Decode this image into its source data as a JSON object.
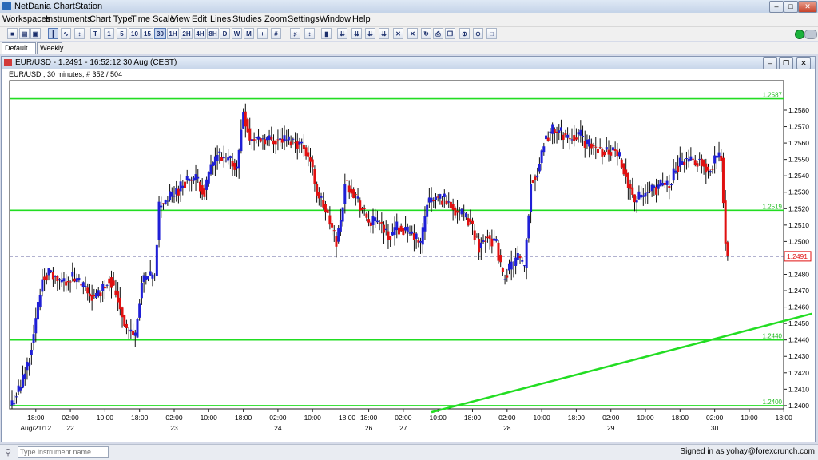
{
  "window": {
    "title": "NetDania ChartStation"
  },
  "menu": [
    "Workspaces",
    "Instruments",
    "Chart Type",
    "Time Scale",
    "View",
    "Edit",
    "Lines",
    "Studies",
    "Zoom",
    "Settings",
    "Window",
    "Help"
  ],
  "toolbar": {
    "timeframes": [
      "T",
      "1",
      "5",
      "10",
      "15",
      "30",
      "1H",
      "2H",
      "4H",
      "8H",
      "D",
      "W",
      "M"
    ],
    "selected": "30"
  },
  "tabs": [
    {
      "label": "Default",
      "active": true
    },
    {
      "label": "Weekly",
      "active": false
    }
  ],
  "chart_window": {
    "title": "EUR/USD - 1.2491 - 16:52:12  30 Aug (CEST)",
    "info": "EUR/USD , 30 minutes, # 352 / 504"
  },
  "status": {
    "search_placeholder": "Type instrument name",
    "signed_in": "Signed in as yohay@forexcrunch.com"
  },
  "chart_data": {
    "type": "candlestick",
    "symbol": "EUR/USD",
    "interval": "30 minutes",
    "ylim": [
      1.2398,
      1.2598
    ],
    "y_ticks": [
      "1.2400",
      "1.2410",
      "1.2420",
      "1.2430",
      "1.2440",
      "1.2450",
      "1.2460",
      "1.2470",
      "1.2480",
      "1.2490",
      "1.2500",
      "1.2510",
      "1.2520",
      "1.2530",
      "1.2540",
      "1.2550",
      "1.2560",
      "1.2570",
      "1.2580"
    ],
    "x_ticks": [
      {
        "time": "18:00",
        "date": "Aug/21/12",
        "i": 11
      },
      {
        "time": "02:00",
        "date": "22",
        "i": 27
      },
      {
        "time": "10:00",
        "date": "",
        "i": 43
      },
      {
        "time": "18:00",
        "date": "",
        "i": 59
      },
      {
        "time": "02:00",
        "date": "23",
        "i": 75
      },
      {
        "time": "10:00",
        "date": "",
        "i": 91
      },
      {
        "time": "18:00",
        "date": "",
        "i": 107
      },
      {
        "time": "02:00",
        "date": "24",
        "i": 123
      },
      {
        "time": "10:00",
        "date": "",
        "i": 139
      },
      {
        "time": "18:00",
        "date": "",
        "i": 155
      },
      {
        "time": "18:00",
        "date": "26",
        "i": 165
      },
      {
        "time": "02:00",
        "date": "27",
        "i": 181
      },
      {
        "time": "10:00",
        "date": "",
        "i": 197
      },
      {
        "time": "18:00",
        "date": "",
        "i": 213
      },
      {
        "time": "02:00",
        "date": "28",
        "i": 229
      },
      {
        "time": "10:00",
        "date": "",
        "i": 245
      },
      {
        "time": "18:00",
        "date": "",
        "i": 261
      },
      {
        "time": "02:00",
        "date": "29",
        "i": 277
      },
      {
        "time": "10:00",
        "date": "",
        "i": 293
      },
      {
        "time": "18:00",
        "date": "",
        "i": 309
      },
      {
        "time": "02:00",
        "date": "30",
        "i": 325
      },
      {
        "time": "10:00",
        "date": "",
        "i": 341
      },
      {
        "time": "18:00",
        "date": "",
        "i": 357
      }
    ],
    "bar_count": 352,
    "current_price": "1.2491",
    "horizontal_lines": [
      {
        "value": 1.2587,
        "label": "1.2587"
      },
      {
        "value": 1.2519,
        "label": "1.2519"
      },
      {
        "value": 1.244,
        "label": "1.2440"
      },
      {
        "value": 1.24,
        "label": "1.2400"
      }
    ],
    "trendline": {
      "from": {
        "i": 194,
        "value": 1.2396
      },
      "to": {
        "i": 370,
        "value": 1.2456
      }
    },
    "colors": {
      "up": "#1f1fd6",
      "down": "#e01010",
      "lines": "#22dd22",
      "price_tag": "#e01010"
    },
    "anchors": [
      [
        0,
        1.2402
      ],
      [
        4,
        1.2412
      ],
      [
        8,
        1.243
      ],
      [
        11,
        1.2452
      ],
      [
        14,
        1.2478
      ],
      [
        17,
        1.2481
      ],
      [
        22,
        1.2475
      ],
      [
        28,
        1.2478
      ],
      [
        33,
        1.2472
      ],
      [
        38,
        1.2465
      ],
      [
        41,
        1.247
      ],
      [
        45,
        1.2478
      ],
      [
        49,
        1.2465
      ],
      [
        53,
        1.2446
      ],
      [
        57,
        1.2443
      ],
      [
        60,
        1.2475
      ],
      [
        63,
        1.2478
      ],
      [
        66,
        1.2478
      ],
      [
        68,
        1.2522
      ],
      [
        72,
        1.2526
      ],
      [
        77,
        1.2532
      ],
      [
        81,
        1.2538
      ],
      [
        85,
        1.2538
      ],
      [
        89,
        1.253
      ],
      [
        92,
        1.2545
      ],
      [
        95,
        1.2553
      ],
      [
        98,
        1.2548
      ],
      [
        101,
        1.255
      ],
      [
        104,
        1.2544
      ],
      [
        107,
        1.258
      ],
      [
        110,
        1.2562
      ],
      [
        115,
        1.2563
      ],
      [
        121,
        1.2562
      ],
      [
        126,
        1.2562
      ],
      [
        131,
        1.2561
      ],
      [
        135,
        1.2558
      ],
      [
        138,
        1.2549
      ],
      [
        141,
        1.253
      ],
      [
        144,
        1.2522
      ],
      [
        147,
        1.2511
      ],
      [
        150,
        1.25
      ],
      [
        152,
        1.2512
      ],
      [
        154,
        1.2536
      ],
      [
        157,
        1.2532
      ],
      [
        160,
        1.2525
      ],
      [
        163,
        1.2516
      ],
      [
        166,
        1.2511
      ],
      [
        170,
        1.2513
      ],
      [
        174,
        1.2502
      ],
      [
        178,
        1.2509
      ],
      [
        182,
        1.2506
      ],
      [
        186,
        1.2503
      ],
      [
        189,
        1.2498
      ],
      [
        192,
        1.2524
      ],
      [
        196,
        1.2526
      ],
      [
        200,
        1.2526
      ],
      [
        204,
        1.2521
      ],
      [
        208,
        1.2516
      ],
      [
        212,
        1.2512
      ],
      [
        216,
        1.2497
      ],
      [
        220,
        1.2504
      ],
      [
        224,
        1.2498
      ],
      [
        227,
        1.2478
      ],
      [
        230,
        1.2483
      ],
      [
        234,
        1.249
      ],
      [
        237,
        1.2483
      ],
      [
        240,
        1.2536
      ],
      [
        243,
        1.2542
      ],
      [
        246,
        1.2561
      ],
      [
        250,
        1.2568
      ],
      [
        254,
        1.2566
      ],
      [
        258,
        1.2563
      ],
      [
        262,
        1.2566
      ],
      [
        266,
        1.2559
      ],
      [
        270,
        1.2557
      ],
      [
        274,
        1.2555
      ],
      [
        278,
        1.2556
      ],
      [
        282,
        1.2549
      ],
      [
        285,
        1.2536
      ],
      [
        288,
        1.2525
      ],
      [
        292,
        1.2528
      ],
      [
        296,
        1.2531
      ],
      [
        300,
        1.2534
      ],
      [
        304,
        1.2535
      ],
      [
        307,
        1.2545
      ],
      [
        311,
        1.255
      ],
      [
        315,
        1.2549
      ],
      [
        319,
        1.255
      ],
      [
        322,
        1.2542
      ],
      [
        325,
        1.255
      ],
      [
        328,
        1.2552
      ],
      [
        330,
        1.25
      ],
      [
        331,
        1.2491
      ]
    ]
  }
}
